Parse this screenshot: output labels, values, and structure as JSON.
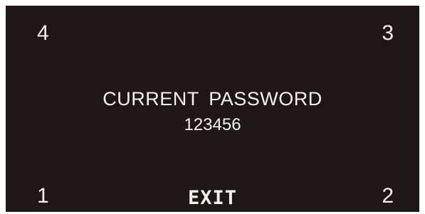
{
  "display": {
    "corner_labels": {
      "top_left": "4",
      "top_right": "3",
      "bottom_left": "1",
      "bottom_right": "2"
    },
    "title": "CURRENT  PASSWORD",
    "password_value": "123456",
    "exit_label": "EXIT"
  },
  "colors": {
    "screen_background": "#1f1715",
    "text": "#f2f2f2",
    "page_background": "#ffffff"
  }
}
